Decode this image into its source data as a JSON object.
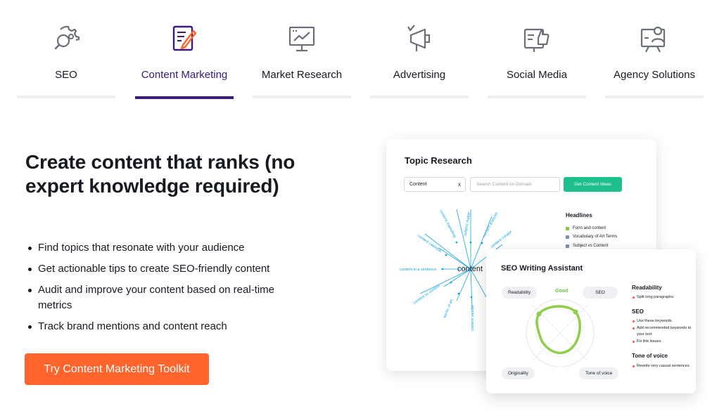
{
  "tabs": [
    {
      "label": "SEO",
      "icon": "seo-gear-magnifier-icon",
      "active": false
    },
    {
      "label": "Content Marketing",
      "icon": "content-document-pen-icon",
      "active": true
    },
    {
      "label": "Market Research",
      "icon": "market-chart-board-icon",
      "active": false
    },
    {
      "label": "Advertising",
      "icon": "megaphone-icon",
      "active": false
    },
    {
      "label": "Social Media",
      "icon": "thumbs-up-icon",
      "active": false
    },
    {
      "label": "Agency Solutions",
      "icon": "presenter-board-icon",
      "active": false
    }
  ],
  "hero": {
    "title": "Create content that ranks (no expert knowledge required)",
    "benefits": [
      "Find topics that resonate with your audience",
      "Get actionable tips to create SEO-friendly content",
      "Audit and improve your content based on real-time metrics",
      "Track brand mentions and content reach"
    ],
    "cta": "Try Content Marketing Toolkit"
  },
  "topic_research": {
    "title": "Topic Research",
    "input_value": "Content",
    "clear": "x",
    "search_placeholder": "Search Content on Domain",
    "button": "Get Content Ideas",
    "center_word": "content",
    "spokes": [
      "content marketing",
      "subject matter",
      "content analysis",
      "content creator",
      "content calendar",
      "content in a sentence",
      "content vs context",
      "works of art",
      "content validity"
    ],
    "headlines_title": "Headlines",
    "headlines": [
      "Form and content",
      "Vocabulary of Art Terms",
      "Subject vs Content"
    ]
  },
  "seo_writing_assistant": {
    "title": "SEO Writing Assistant",
    "good": "Good",
    "pills": {
      "readability": "Readability",
      "seo": "SEO",
      "originality": "Originality",
      "tone": "Tone of voice"
    },
    "side": {
      "readability_title": "Readability",
      "readability_items": [
        "Split long paragraphs."
      ],
      "seo_title": "SEO",
      "seo_items": [
        "Use these keywords.",
        "Add recommended keywords to your text",
        "Fix link issues."
      ],
      "tone_title": "Tone of voice",
      "tone_items": [
        "Rewrite very casual sentences."
      ]
    }
  },
  "colors": {
    "accent_orange": "#ff642d",
    "active_tab_purple": "#3d1a7e",
    "green": "#1dbf8d",
    "blue_spoke": "#12a6e0",
    "good_green": "#6cc24a"
  }
}
